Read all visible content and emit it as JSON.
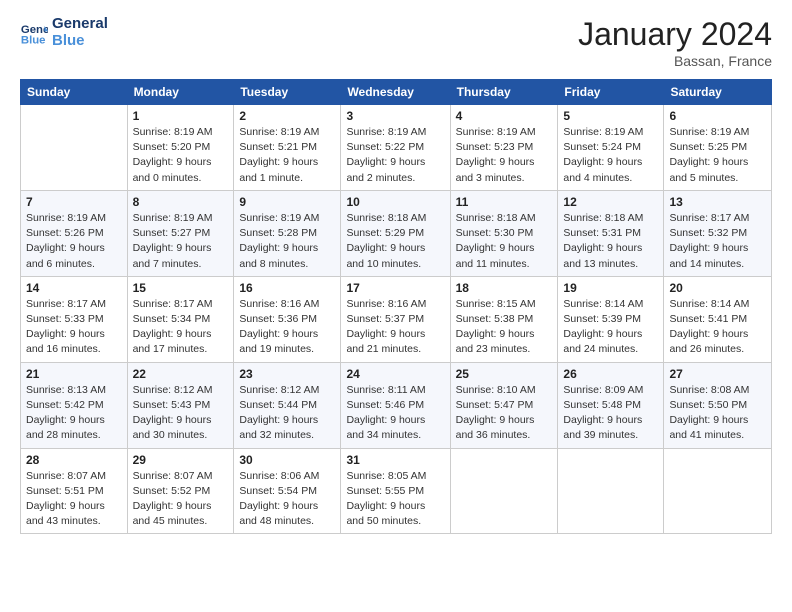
{
  "logo": {
    "line1": "General",
    "line2": "Blue"
  },
  "title": "January 2024",
  "location": "Bassan, France",
  "days_of_week": [
    "Sunday",
    "Monday",
    "Tuesday",
    "Wednesday",
    "Thursday",
    "Friday",
    "Saturday"
  ],
  "weeks": [
    [
      {
        "day": "",
        "info": ""
      },
      {
        "day": "1",
        "info": "Sunrise: 8:19 AM\nSunset: 5:20 PM\nDaylight: 9 hours\nand 0 minutes."
      },
      {
        "day": "2",
        "info": "Sunrise: 8:19 AM\nSunset: 5:21 PM\nDaylight: 9 hours\nand 1 minute."
      },
      {
        "day": "3",
        "info": "Sunrise: 8:19 AM\nSunset: 5:22 PM\nDaylight: 9 hours\nand 2 minutes."
      },
      {
        "day": "4",
        "info": "Sunrise: 8:19 AM\nSunset: 5:23 PM\nDaylight: 9 hours\nand 3 minutes."
      },
      {
        "day": "5",
        "info": "Sunrise: 8:19 AM\nSunset: 5:24 PM\nDaylight: 9 hours\nand 4 minutes."
      },
      {
        "day": "6",
        "info": "Sunrise: 8:19 AM\nSunset: 5:25 PM\nDaylight: 9 hours\nand 5 minutes."
      }
    ],
    [
      {
        "day": "7",
        "info": "Sunrise: 8:19 AM\nSunset: 5:26 PM\nDaylight: 9 hours\nand 6 minutes."
      },
      {
        "day": "8",
        "info": "Sunrise: 8:19 AM\nSunset: 5:27 PM\nDaylight: 9 hours\nand 7 minutes."
      },
      {
        "day": "9",
        "info": "Sunrise: 8:19 AM\nSunset: 5:28 PM\nDaylight: 9 hours\nand 8 minutes."
      },
      {
        "day": "10",
        "info": "Sunrise: 8:18 AM\nSunset: 5:29 PM\nDaylight: 9 hours\nand 10 minutes."
      },
      {
        "day": "11",
        "info": "Sunrise: 8:18 AM\nSunset: 5:30 PM\nDaylight: 9 hours\nand 11 minutes."
      },
      {
        "day": "12",
        "info": "Sunrise: 8:18 AM\nSunset: 5:31 PM\nDaylight: 9 hours\nand 13 minutes."
      },
      {
        "day": "13",
        "info": "Sunrise: 8:17 AM\nSunset: 5:32 PM\nDaylight: 9 hours\nand 14 minutes."
      }
    ],
    [
      {
        "day": "14",
        "info": "Sunrise: 8:17 AM\nSunset: 5:33 PM\nDaylight: 9 hours\nand 16 minutes."
      },
      {
        "day": "15",
        "info": "Sunrise: 8:17 AM\nSunset: 5:34 PM\nDaylight: 9 hours\nand 17 minutes."
      },
      {
        "day": "16",
        "info": "Sunrise: 8:16 AM\nSunset: 5:36 PM\nDaylight: 9 hours\nand 19 minutes."
      },
      {
        "day": "17",
        "info": "Sunrise: 8:16 AM\nSunset: 5:37 PM\nDaylight: 9 hours\nand 21 minutes."
      },
      {
        "day": "18",
        "info": "Sunrise: 8:15 AM\nSunset: 5:38 PM\nDaylight: 9 hours\nand 23 minutes."
      },
      {
        "day": "19",
        "info": "Sunrise: 8:14 AM\nSunset: 5:39 PM\nDaylight: 9 hours\nand 24 minutes."
      },
      {
        "day": "20",
        "info": "Sunrise: 8:14 AM\nSunset: 5:41 PM\nDaylight: 9 hours\nand 26 minutes."
      }
    ],
    [
      {
        "day": "21",
        "info": "Sunrise: 8:13 AM\nSunset: 5:42 PM\nDaylight: 9 hours\nand 28 minutes."
      },
      {
        "day": "22",
        "info": "Sunrise: 8:12 AM\nSunset: 5:43 PM\nDaylight: 9 hours\nand 30 minutes."
      },
      {
        "day": "23",
        "info": "Sunrise: 8:12 AM\nSunset: 5:44 PM\nDaylight: 9 hours\nand 32 minutes."
      },
      {
        "day": "24",
        "info": "Sunrise: 8:11 AM\nSunset: 5:46 PM\nDaylight: 9 hours\nand 34 minutes."
      },
      {
        "day": "25",
        "info": "Sunrise: 8:10 AM\nSunset: 5:47 PM\nDaylight: 9 hours\nand 36 minutes."
      },
      {
        "day": "26",
        "info": "Sunrise: 8:09 AM\nSunset: 5:48 PM\nDaylight: 9 hours\nand 39 minutes."
      },
      {
        "day": "27",
        "info": "Sunrise: 8:08 AM\nSunset: 5:50 PM\nDaylight: 9 hours\nand 41 minutes."
      }
    ],
    [
      {
        "day": "28",
        "info": "Sunrise: 8:07 AM\nSunset: 5:51 PM\nDaylight: 9 hours\nand 43 minutes."
      },
      {
        "day": "29",
        "info": "Sunrise: 8:07 AM\nSunset: 5:52 PM\nDaylight: 9 hours\nand 45 minutes."
      },
      {
        "day": "30",
        "info": "Sunrise: 8:06 AM\nSunset: 5:54 PM\nDaylight: 9 hours\nand 48 minutes."
      },
      {
        "day": "31",
        "info": "Sunrise: 8:05 AM\nSunset: 5:55 PM\nDaylight: 9 hours\nand 50 minutes."
      },
      {
        "day": "",
        "info": ""
      },
      {
        "day": "",
        "info": ""
      },
      {
        "day": "",
        "info": ""
      }
    ]
  ]
}
